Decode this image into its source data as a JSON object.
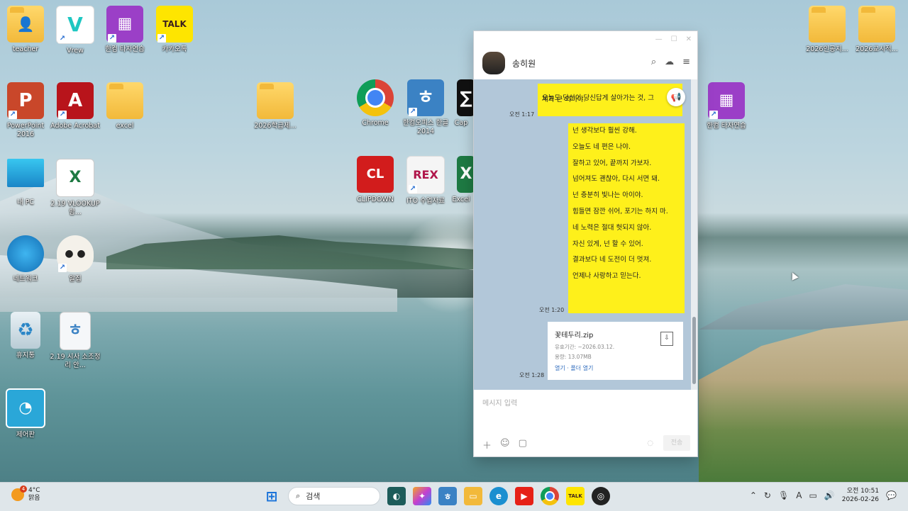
{
  "desktop": {
    "icons": [
      {
        "id": "teacher",
        "label": "teacher",
        "glyph": "👤",
        "color": "#f2b93a"
      },
      {
        "id": "vrew",
        "label": "Vrew",
        "glyph": "V",
        "color": "#ffffff"
      },
      {
        "id": "hancom-typing",
        "label": "한컴 타자연습",
        "glyph": "▦",
        "color": "#9b3fc7"
      },
      {
        "id": "kakaotalk",
        "label": "카카오톡",
        "glyph": "TALK",
        "color": "#fee500"
      },
      {
        "id": "powerpoint",
        "label": "PowerPoint 2016",
        "glyph": "P",
        "color": "#c9472a"
      },
      {
        "id": "acrobat",
        "label": "Adobe Acrobat",
        "glyph": "A",
        "color": "#b8141b"
      },
      {
        "id": "excel-folder",
        "label": "excel",
        "glyph": "",
        "color": "#f2b93a"
      },
      {
        "id": "folder-2026",
        "label": "2026학급제...",
        "glyph": "",
        "color": "#f2b93a"
      },
      {
        "id": "chrome",
        "label": "Chrome",
        "glyph": "●",
        "color": "#ffffff"
      },
      {
        "id": "hancom-office",
        "label": "한컴오피스 한글 2014",
        "glyph": "ㅎ",
        "color": "#3b82c4"
      },
      {
        "id": "cap",
        "label": "Cap",
        "glyph": "∑",
        "color": "#111111"
      },
      {
        "id": "my-pc",
        "label": "내 PC",
        "glyph": "▭",
        "color": "#2aa7d8"
      },
      {
        "id": "vlookup",
        "label": "2.19 VLOOKUP함...",
        "glyph": "X",
        "color": "#1e7a43"
      },
      {
        "id": "clipdown",
        "label": "CLIPDOWN",
        "glyph": "CL",
        "color": "#d21c1c"
      },
      {
        "id": "ito",
        "label": "ITO 수업자료",
        "glyph": "REX",
        "color": "#b0164b"
      },
      {
        "id": "excel-app",
        "label": "Excel",
        "glyph": "X",
        "color": "#1e7a43"
      },
      {
        "id": "network",
        "label": "네트워크",
        "glyph": "◍",
        "color": "#1d8fd0"
      },
      {
        "id": "alzip",
        "label": "알집",
        "glyph": "◉",
        "color": "#f4f1ea"
      },
      {
        "id": "recycle",
        "label": "휴지통",
        "glyph": "♻",
        "color": "#cfdde6"
      },
      {
        "id": "doc-219",
        "label": "2.19 시사 소조정리 안...",
        "glyph": "ㅎ",
        "color": "#3b82c4"
      },
      {
        "id": "control",
        "label": "제어판",
        "glyph": "◔",
        "color": "#2aa7d8"
      },
      {
        "id": "typing2",
        "label": "한컴 타자연습",
        "glyph": "▦",
        "color": "#9b3fc7"
      },
      {
        "id": "folder-a",
        "label": "2026인공지...",
        "glyph": "",
        "color": "#f2b93a"
      },
      {
        "id": "folder-b",
        "label": "2026교시적...",
        "glyph": "",
        "color": "#f2b93a"
      }
    ]
  },
  "chat": {
    "contact_name": "송히원",
    "messages": [
      {
        "time": "오전 1:17",
        "lines": [
          "오늘도 당신이 당신답게 살아가는 것, 그",
          "체가 큰 의미야."
        ]
      },
      {
        "time": "오전 1:20",
        "lines": [
          "넌 생각보다 훨씬 강해.",
          "오늘도 네 편은 나야.",
          "잘하고 있어, 끝까지 가보자.",
          "넘어져도 괜찮아, 다시 서면 돼.",
          "넌 충분히 빛나는 아이야.",
          "힘들면 잠깐 쉬어, 포기는 하지 마.",
          "네 노력은 절대 헛되지 않아.",
          "자신 있게, 넌 할 수 있어.",
          "결과보다 네 도전이 더 멋져.",
          "언제나 사랑하고 믿는다."
        ]
      }
    ],
    "file": {
      "time": "오전 1:28",
      "name": "꽃테두리.zip",
      "expiry": "유효기간: ~2026.03.12.",
      "size": "용량: 13.07MB",
      "actions": "열기 · 폴더 열기"
    },
    "composer": {
      "placeholder": "메시지 입력",
      "send_label": "전송"
    }
  },
  "taskbar": {
    "weather_temp": "4°C",
    "weather_desc": "맑음",
    "weather_badge": "4",
    "search_placeholder": "검색",
    "time": "오전 10:51",
    "date": "2026-02-26"
  }
}
